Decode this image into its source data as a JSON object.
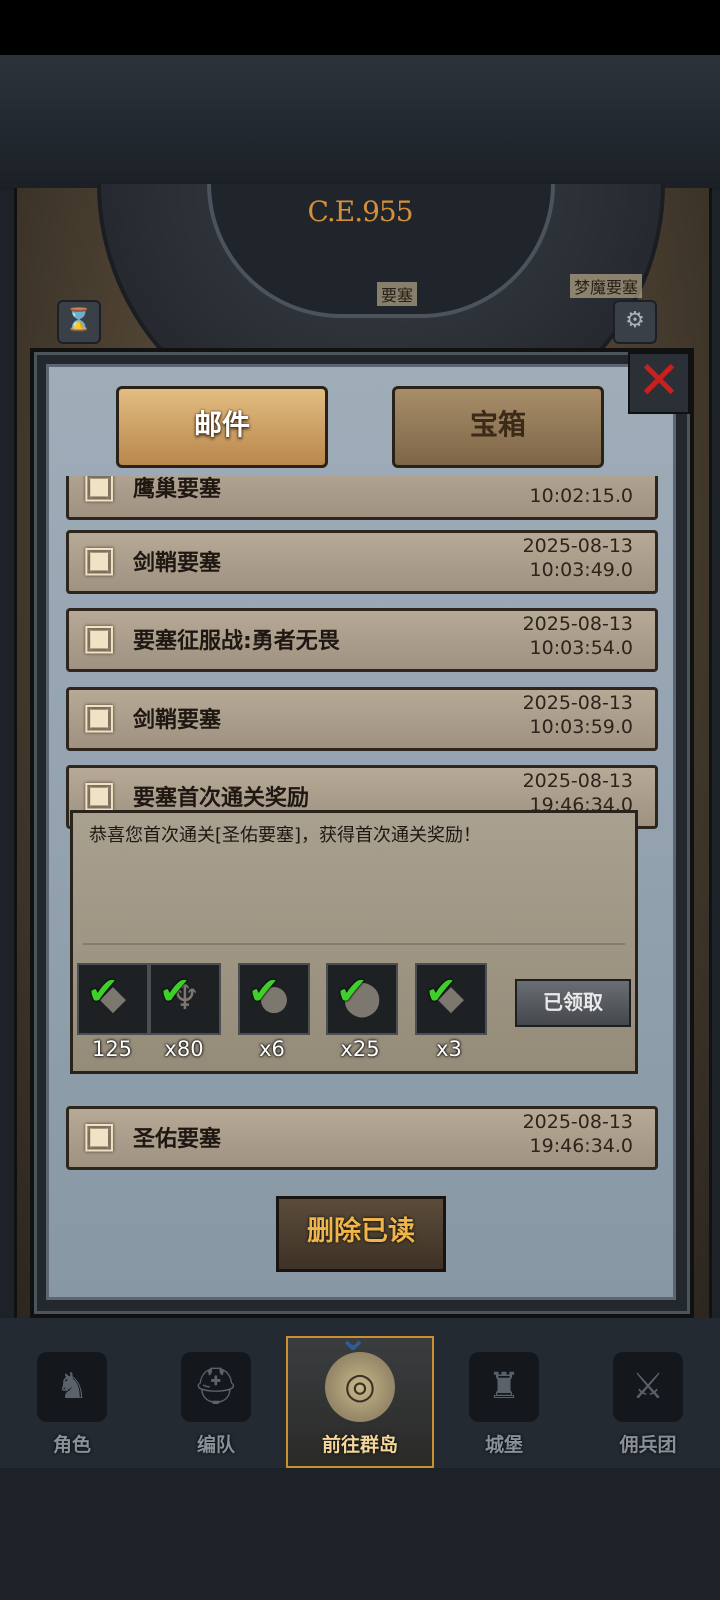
{
  "map": {
    "era": "C.E.955",
    "labels": [
      "梦魔要塞",
      "要塞"
    ],
    "icons": [
      "hourglass-icon",
      "gear-icon"
    ]
  },
  "tabs": {
    "mail": "邮件",
    "chest": "宝箱"
  },
  "mails": [
    {
      "title": "鹰巢要塞",
      "date": "",
      "time": "10:02:15.0"
    },
    {
      "title": "剑鞘要塞",
      "date": "2025-08-13",
      "time": "10:03:49.0"
    },
    {
      "title": "要塞征服战:勇者无畏",
      "date": "2025-08-13",
      "time": "10:03:54.0"
    },
    {
      "title": "剑鞘要塞",
      "date": "2025-08-13",
      "time": "10:03:59.0"
    },
    {
      "title": "要塞首次通关奖励",
      "date": "2025-08-13",
      "time": "19:46:34.0"
    },
    {
      "title": "圣佑要塞",
      "date": "2025-08-13",
      "time": "19:46:34.0"
    }
  ],
  "detail": {
    "message": "恭喜您首次通关[圣佑要塞]，获得首次通关奖励！",
    "rewards": [
      {
        "icon": "ore-icon",
        "count": "125"
      },
      {
        "icon": "goblet-icon",
        "count": "x80"
      },
      {
        "icon": "stone-icon",
        "count": "x6"
      },
      {
        "icon": "rock-pile-icon",
        "count": "x25"
      },
      {
        "icon": "ore-chunk-icon",
        "count": "x3"
      }
    ],
    "claimed_label": "已领取"
  },
  "delete_read_label": "删除已读",
  "nav": [
    {
      "label": "角色",
      "icon": "knight-icon"
    },
    {
      "label": "编队",
      "icon": "helmet-icon"
    },
    {
      "label": "前往群岛",
      "icon": "globe-icon",
      "active": true
    },
    {
      "label": "城堡",
      "icon": "castle-icon"
    },
    {
      "label": "佣兵团",
      "icon": "mercenary-icon"
    }
  ],
  "colors": {
    "accent_gold": "#c9902e",
    "close_red": "#c91f1f",
    "check_green": "#3fcf2a",
    "delete_text": "#f0b54a"
  }
}
